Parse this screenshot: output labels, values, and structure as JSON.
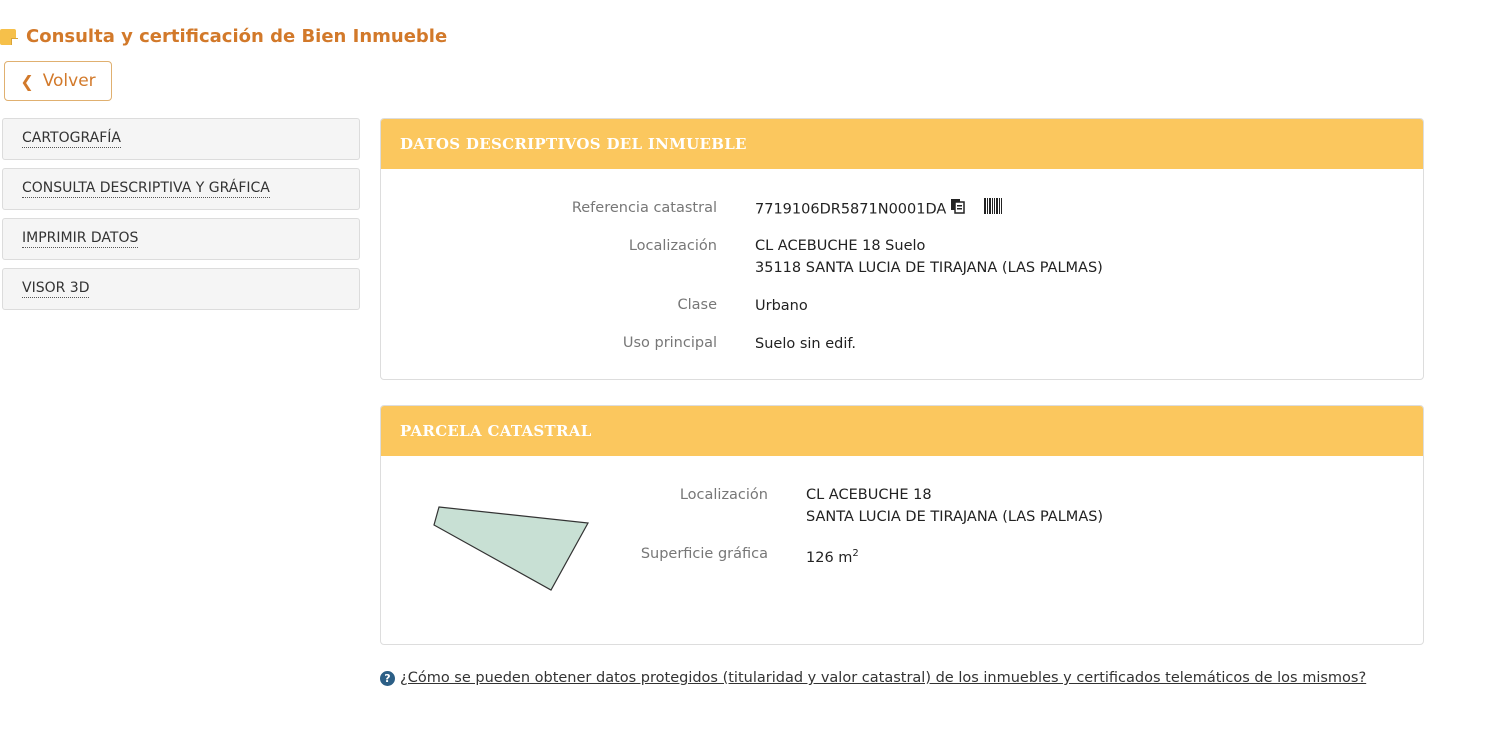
{
  "page": {
    "title": "Consulta y certificación de Bien Inmueble",
    "back_label": "Volver"
  },
  "sidebar": {
    "items": [
      {
        "label": "CARTOGRAFÍA"
      },
      {
        "label": "CONSULTA DESCRIPTIVA Y GRÁFICA"
      },
      {
        "label": "IMPRIMIR DATOS"
      },
      {
        "label": "VISOR 3D"
      }
    ]
  },
  "datos": {
    "header": "DATOS DESCRIPTIVOS DEL INMUEBLE",
    "referencia_label": "Referencia catastral",
    "referencia_value": "7719106DR5871N0001DA",
    "localizacion_label": "Localización",
    "localizacion_line1": "CL ACEBUCHE 18 Suelo",
    "localizacion_line2": "35118 SANTA LUCIA DE TIRAJANA (LAS PALMAS)",
    "clase_label": "Clase",
    "clase_value": "Urbano",
    "uso_label": "Uso principal",
    "uso_value": "Suelo sin edif."
  },
  "parcela": {
    "header": "PARCELA CATASTRAL",
    "localizacion_label": "Localización",
    "localizacion_line1": "CL ACEBUCHE 18",
    "localizacion_line2": "SANTA LUCIA DE TIRAJANA (LAS PALMAS)",
    "superficie_label": "Superficie gráfica",
    "superficie_value": "126 m",
    "superficie_unit_sup": "2",
    "shape_fill": "#c8e0d4",
    "shape_stroke": "#333333"
  },
  "help": {
    "icon": "question-circle-icon",
    "text": "¿Cómo se pueden obtener datos protegidos (titularidad y valor catastral) de los inmuebles y certificados telemáticos de los mismos?"
  },
  "colors": {
    "accent": "#d2792a",
    "panel_header": "#fbc75e",
    "help_icon": "#2c5f86"
  }
}
